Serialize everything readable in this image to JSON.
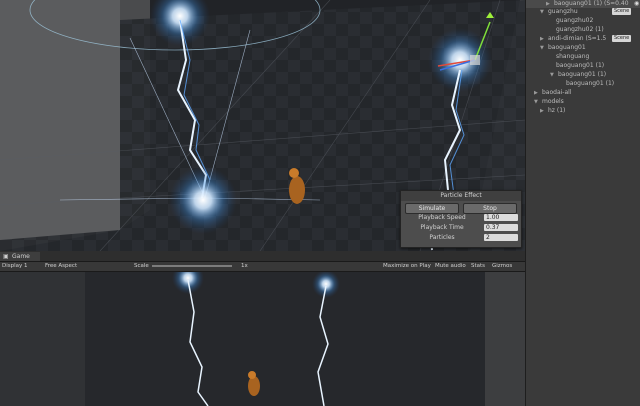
{
  "hierarchy": {
    "scene_tag": "Scene",
    "items": [
      {
        "label": "baoguang01 (1) (S=0.40",
        "selected": true
      },
      {
        "label": "guangzhu"
      },
      {
        "label": "guangzhu02"
      },
      {
        "label": "guangzhu02 (1)"
      },
      {
        "label": "andi-dimian (S=1.5"
      },
      {
        "label": "baoguang01"
      },
      {
        "label": "shanguang"
      },
      {
        "label": "baoguang01 (1)"
      },
      {
        "label": "baoguang01 (1)"
      },
      {
        "label": "baoguang01 (1)"
      },
      {
        "label": "baodai-all"
      },
      {
        "label": "models"
      },
      {
        "label": "hz (1)"
      }
    ]
  },
  "particle_effect": {
    "title": "Particle Effect",
    "simulate_label": "Simulate",
    "stop_label": "Stop",
    "playback_speed_label": "Playback Speed",
    "playback_speed_value": "1.00",
    "playback_time_label": "Playback Time",
    "playback_time_value": "0.37",
    "particles_label": "Particles",
    "particles_value": "2"
  },
  "game_tab": {
    "label": "Game"
  },
  "game_toolbar": {
    "display": "Display 1",
    "aspect": "Free Aspect",
    "scale_label": "Scale",
    "scale_value": "1x",
    "maximize": "Maximize on Play",
    "mute": "Mute audio",
    "stats": "Stats",
    "gizmos": "Gizmos"
  },
  "icons": {
    "eye": "eye-icon",
    "speaker": "speaker-icon",
    "arrow": "foldout-arrow-icon",
    "game": "game-controller-icon"
  }
}
